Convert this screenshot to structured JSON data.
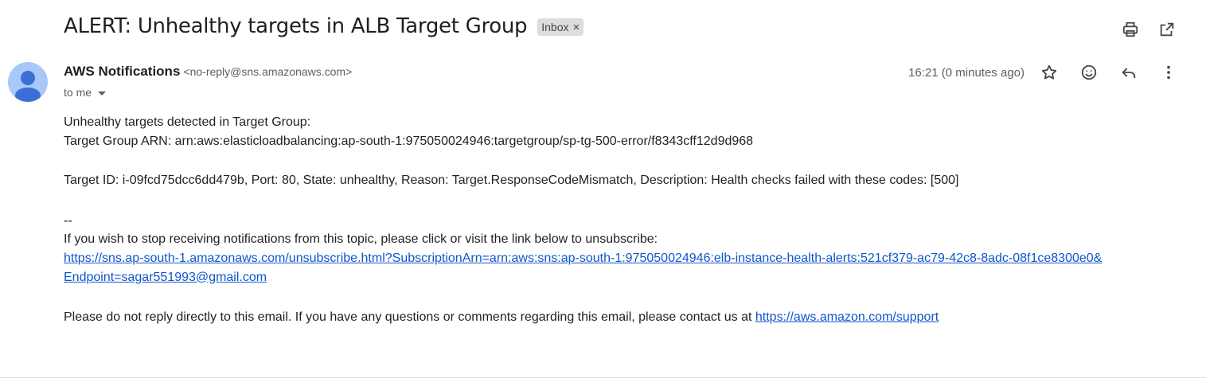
{
  "email": {
    "subject": "ALERT: Unhealthy targets in ALB Target Group",
    "label": "Inbox",
    "label_close": "×",
    "sender": {
      "name": "AWS Notifications",
      "email": "<no-reply@sns.amazonaws.com>"
    },
    "recipient": "to me",
    "timestamp": "16:21 (0 minutes ago)",
    "body": {
      "line1": "Unhealthy targets detected in Target Group:",
      "line2": "Target Group ARN: arn:aws:elasticloadbalancing:ap-south-1:975050024946:targetgroup/sp-tg-500-error/f8343cff12d9d968",
      "line3": "Target ID: i-09fcd75dcc6dd479b, Port: 80, State: unhealthy, Reason: Target.ResponseCodeMismatch, Description: Health checks failed with these codes: [500]",
      "separator": "--",
      "unsubscribe_text": "If you wish to stop receiving notifications from this topic, please click or visit the link below to unsubscribe:",
      "unsubscribe_link_line1": "https://sns.ap-south-1.amazonaws.com/unsubscribe.html?SubscriptionArn=arn:aws:sns:ap-south-1:975050024946:elb-instance-health-alerts:521cf379-ac79-42c8-8adc-08f1ce8300e0&",
      "unsubscribe_link_line2": "Endpoint=sagar551993@gmail.com",
      "footer_text": "Please do not reply directly to this email. If you have any questions or comments regarding this email, please contact us at ",
      "support_link": "https://aws.amazon.com/support"
    }
  },
  "icons": {
    "print": "print-icon",
    "open_new_window": "open-in-new-window-icon",
    "star": "star-icon",
    "emoji": "emoji-reaction-icon",
    "reply": "reply-icon",
    "more": "more-vert-icon",
    "avatar": "person-avatar-icon"
  },
  "colors": {
    "link": "#1155cc",
    "avatar_bg": "#a8c7fa",
    "avatar_fg": "#3b6fd6",
    "chip_bg": "#dddddd"
  }
}
